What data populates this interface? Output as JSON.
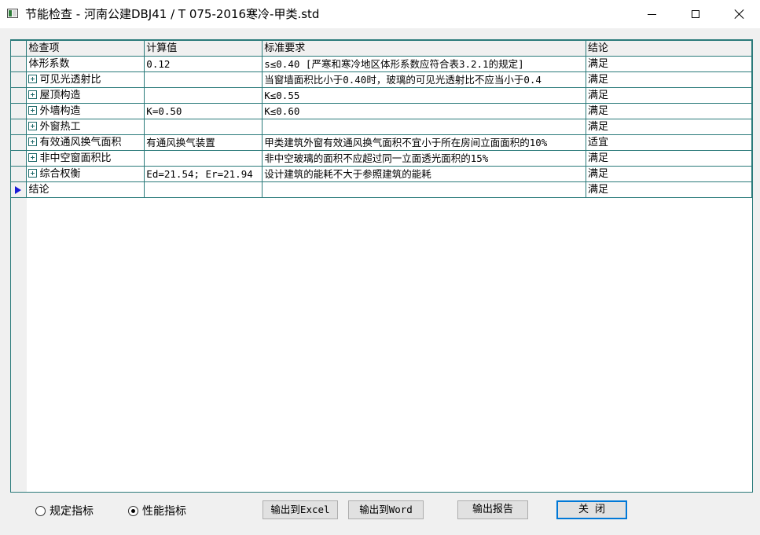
{
  "window": {
    "title": "节能检查 - 河南公建DBJ41 / T 075-2016寒冷-甲类.std",
    "icon": "app-window-icon",
    "controls": [
      "minimize-icon",
      "maximize-icon",
      "close-icon"
    ]
  },
  "grid": {
    "columns": [
      "检查项",
      "计算值",
      "标准要求",
      "结论"
    ],
    "rows": [
      {
        "item": "体形系数",
        "expandable": false,
        "value": "0.12",
        "requirement": "s≤0.40 [严寒和寒冷地区体形系数应符合表3.2.1的规定]",
        "result": "满足"
      },
      {
        "item": "可见光透射比",
        "expandable": true,
        "value": "",
        "requirement": "当窗墙面积比小于0.40时，玻璃的可见光透射比不应当小于0.4",
        "result": "满足"
      },
      {
        "item": "屋顶构造",
        "expandable": true,
        "value": "",
        "requirement": "K≤0.55",
        "result": "满足"
      },
      {
        "item": "外墙构造",
        "expandable": true,
        "value": "K=0.50",
        "requirement": "K≤0.60",
        "result": "满足"
      },
      {
        "item": "外窗热工",
        "expandable": true,
        "value": "",
        "requirement": "",
        "result": "满足"
      },
      {
        "item": "有效通风换气面积",
        "expandable": true,
        "value": "有通风换气装置",
        "requirement": "甲类建筑外窗有效通风换气面积不宜小于所在房间立面面积的10%",
        "result": "适宜"
      },
      {
        "item": "非中空窗面积比",
        "expandable": true,
        "value": "",
        "requirement": "非中空玻璃的面积不应超过同一立面透光面积的15%",
        "result": "满足"
      },
      {
        "item": "综合权衡",
        "expandable": true,
        "value": "Ed=21.54; Er=21.94",
        "requirement": "设计建筑的能耗不大于参照建筑的能耗",
        "result": "满足"
      },
      {
        "item": "结论",
        "expandable": false,
        "value": "",
        "requirement": "",
        "result": "满足",
        "current": true
      }
    ]
  },
  "options": {
    "radio_prescriptive": "规定指标",
    "radio_performance": "性能指标",
    "selected": "性能指标"
  },
  "buttons": {
    "export_excel": "输出到Excel",
    "export_word": "输出到Word",
    "export_report": "输出报告",
    "close": "关闭"
  },
  "colors": {
    "grid_line": "#2a7a7a",
    "row_pointer": "#1a1ad6",
    "default_button_border": "#0078d7"
  }
}
